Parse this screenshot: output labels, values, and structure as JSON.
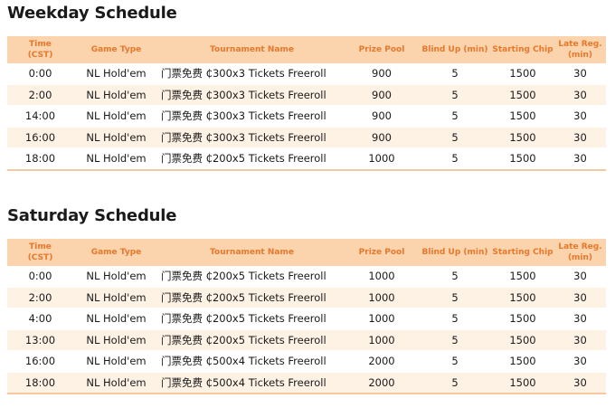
{
  "weekday": {
    "title": "Weekday Schedule",
    "headers": [
      "Time\n(CST)",
      "Game Type",
      "Tournament Name",
      "Prize Pool",
      "Blind Up (min)",
      "Starting Chip",
      "Late Reg. (min)"
    ],
    "rows": [
      [
        "0:00",
        "NL Hold'em",
        "门票免费 ₵300x3 Tickets Freeroll",
        "900",
        "5",
        "1500",
        "30"
      ],
      [
        "2:00",
        "NL Hold'em",
        "门票免费 ₵300x3 Tickets Freeroll",
        "900",
        "5",
        "1500",
        "30"
      ],
      [
        "14:00",
        "NL Hold'em",
        "门票免费 ₵300x3 Tickets Freeroll",
        "900",
        "5",
        "1500",
        "30"
      ],
      [
        "16:00",
        "NL Hold'em",
        "门票免费 ₵300x3 Tickets Freeroll",
        "900",
        "5",
        "1500",
        "30"
      ],
      [
        "18:00",
        "NL Hold'em",
        "门票免费 ₵200x5 Tickets Freeroll",
        "1000",
        "5",
        "1500",
        "30"
      ]
    ]
  },
  "saturday": {
    "title": "Saturday Schedule",
    "headers": [
      "Time\n(CST)",
      "Game Type",
      "Tournament Name",
      "Prize Pool",
      "Blind Up (min)",
      "Starting Chip",
      "Late Reg. (min)"
    ],
    "rows": [
      [
        "0:00",
        "NL Hold'em",
        "门票免费 ₵200x5 Tickets Freeroll",
        "1000",
        "5",
        "1500",
        "30"
      ],
      [
        "2:00",
        "NL Hold'em",
        "门票免费 ₵200x5 Tickets Freeroll",
        "1000",
        "5",
        "1500",
        "30"
      ],
      [
        "4:00",
        "NL Hold'em",
        "门票免费 ₵200x5 Tickets Freeroll",
        "1000",
        "5",
        "1500",
        "30"
      ],
      [
        "13:00",
        "NL Hold'em",
        "门票免费 ₵200x5 Tickets Freeroll",
        "1000",
        "5",
        "1500",
        "30"
      ],
      [
        "16:00",
        "NL Hold'em",
        "门票免费 ₵500x4 Tickets Freeroll",
        "2000",
        "5",
        "1500",
        "30"
      ],
      [
        "18:00",
        "NL Hold'em",
        "门票免费 ₵500x4 Tickets Freeroll",
        "2000",
        "5",
        "1500",
        "30"
      ]
    ]
  },
  "colors": {
    "header_bg": "#fbd3ad",
    "header_text": "#e8782a",
    "row_alt_bg": "#fef2e5"
  }
}
